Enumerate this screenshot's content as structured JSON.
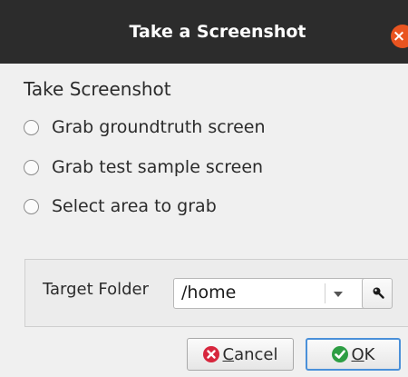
{
  "window": {
    "title": "Take a Screenshot",
    "close_icon": "×"
  },
  "screenshot_group": {
    "title": "Take Screenshot",
    "options": [
      {
        "label": "Grab groundtruth screen",
        "selected": false
      },
      {
        "label": "Grab test sample screen",
        "selected": false
      },
      {
        "label": "Select area to grab",
        "selected": false
      }
    ]
  },
  "target": {
    "label": "Target Folder",
    "value": "/home",
    "browse_icon": "magnifier-icon"
  },
  "buttons": {
    "cancel_first": "C",
    "cancel_rest": "ancel",
    "ok_first": "O",
    "ok_rest": "K"
  },
  "colors": {
    "titlebar": "#2c2c2c",
    "close": "#e95420",
    "cancel_icon": "#d7263d",
    "ok_icon": "#2e9e44",
    "focus_border": "#4a90d9"
  }
}
